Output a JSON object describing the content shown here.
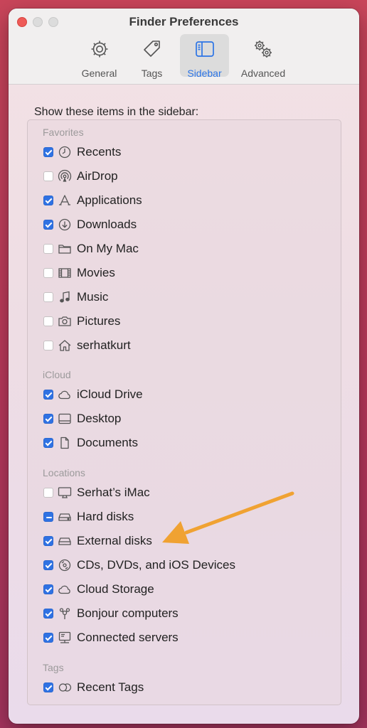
{
  "window": {
    "title": "Finder Preferences"
  },
  "toolbar": {
    "tabs": [
      {
        "label": "General",
        "icon": "gear-icon"
      },
      {
        "label": "Tags",
        "icon": "tag-icon"
      },
      {
        "label": "Sidebar",
        "icon": "sidebar-icon",
        "selected": true
      },
      {
        "label": "Advanced",
        "icon": "gears-icon"
      }
    ]
  },
  "heading": "Show these items in the sidebar:",
  "sections": {
    "favorites": "Favorites",
    "icloud": "iCloud",
    "locations": "Locations",
    "tags": "Tags"
  },
  "items": [
    {
      "label": "Recents",
      "icon": "clock-icon",
      "state": "checked"
    },
    {
      "label": "AirDrop",
      "icon": "airdrop-icon",
      "state": "unchecked"
    },
    {
      "label": "Applications",
      "icon": "applications-icon",
      "state": "checked"
    },
    {
      "label": "Downloads",
      "icon": "download-icon",
      "state": "checked"
    },
    {
      "label": "On My Mac",
      "icon": "folder-icon",
      "state": "unchecked"
    },
    {
      "label": "Movies",
      "icon": "film-icon",
      "state": "unchecked"
    },
    {
      "label": "Music",
      "icon": "music-note-icon",
      "state": "unchecked"
    },
    {
      "label": "Pictures",
      "icon": "camera-icon",
      "state": "unchecked"
    },
    {
      "label": "serhatkurt",
      "icon": "home-icon",
      "state": "unchecked"
    },
    {
      "label": "iCloud Drive",
      "icon": "cloud-icon",
      "state": "checked"
    },
    {
      "label": "Desktop",
      "icon": "desktop-icon",
      "state": "checked"
    },
    {
      "label": "Documents",
      "icon": "document-icon",
      "state": "checked"
    },
    {
      "label": "Serhat’s iMac",
      "icon": "imac-icon",
      "state": "unchecked"
    },
    {
      "label": "Hard disks",
      "icon": "hard-disk-icon",
      "state": "mixed"
    },
    {
      "label": "External disks",
      "icon": "external-disk-icon",
      "state": "checked"
    },
    {
      "label": "CDs, DVDs, and iOS Devices",
      "icon": "disc-icon",
      "state": "checked"
    },
    {
      "label": "Cloud Storage",
      "icon": "cloud-icon",
      "state": "checked"
    },
    {
      "label": "Bonjour computers",
      "icon": "bonjour-icon",
      "state": "checked"
    },
    {
      "label": "Connected servers",
      "icon": "server-icon",
      "state": "checked"
    },
    {
      "label": "Recent Tags",
      "icon": "tags-icon",
      "state": "checked"
    }
  ],
  "colors": {
    "accent": "#2f72e3",
    "annotation_arrow": "#f0a232"
  }
}
